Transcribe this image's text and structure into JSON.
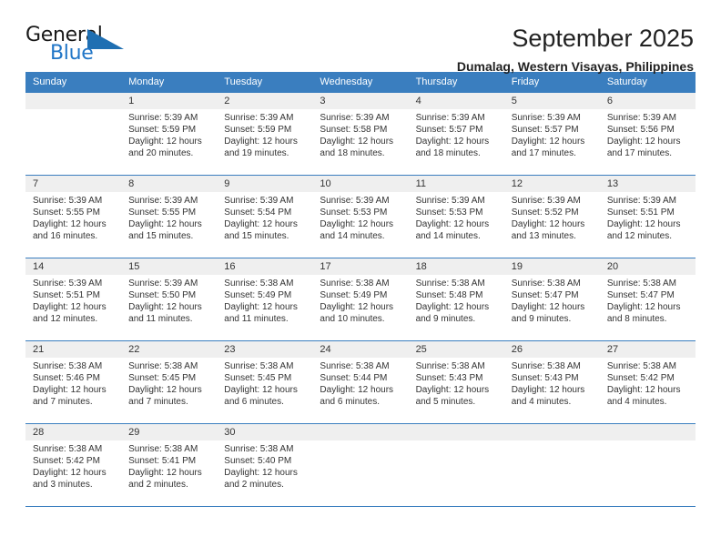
{
  "brand": {
    "word_one": "General",
    "word_two": "Blue",
    "triangle_icon": "triangle-icon"
  },
  "header": {
    "month_title": "September 2025",
    "location": "Dumalag, Western Visayas, Philippines"
  },
  "calendar": {
    "weekday_headers": [
      "Sunday",
      "Monday",
      "Tuesday",
      "Wednesday",
      "Thursday",
      "Friday",
      "Saturday"
    ],
    "colors": {
      "header_blue": "#3a7ebf",
      "daynum_gray": "#efefef",
      "brand_blue": "#2176c7",
      "text": "#333333"
    },
    "weeks": [
      [
        {
          "day": "",
          "sunrise": "",
          "sunset": "",
          "daylight_line1": "",
          "daylight_line2": ""
        },
        {
          "day": "1",
          "sunrise": "Sunrise: 5:39 AM",
          "sunset": "Sunset: 5:59 PM",
          "daylight_line1": "Daylight: 12 hours",
          "daylight_line2": "and 20 minutes."
        },
        {
          "day": "2",
          "sunrise": "Sunrise: 5:39 AM",
          "sunset": "Sunset: 5:59 PM",
          "daylight_line1": "Daylight: 12 hours",
          "daylight_line2": "and 19 minutes."
        },
        {
          "day": "3",
          "sunrise": "Sunrise: 5:39 AM",
          "sunset": "Sunset: 5:58 PM",
          "daylight_line1": "Daylight: 12 hours",
          "daylight_line2": "and 18 minutes."
        },
        {
          "day": "4",
          "sunrise": "Sunrise: 5:39 AM",
          "sunset": "Sunset: 5:57 PM",
          "daylight_line1": "Daylight: 12 hours",
          "daylight_line2": "and 18 minutes."
        },
        {
          "day": "5",
          "sunrise": "Sunrise: 5:39 AM",
          "sunset": "Sunset: 5:57 PM",
          "daylight_line1": "Daylight: 12 hours",
          "daylight_line2": "and 17 minutes."
        },
        {
          "day": "6",
          "sunrise": "Sunrise: 5:39 AM",
          "sunset": "Sunset: 5:56 PM",
          "daylight_line1": "Daylight: 12 hours",
          "daylight_line2": "and 17 minutes."
        }
      ],
      [
        {
          "day": "7",
          "sunrise": "Sunrise: 5:39 AM",
          "sunset": "Sunset: 5:55 PM",
          "daylight_line1": "Daylight: 12 hours",
          "daylight_line2": "and 16 minutes."
        },
        {
          "day": "8",
          "sunrise": "Sunrise: 5:39 AM",
          "sunset": "Sunset: 5:55 PM",
          "daylight_line1": "Daylight: 12 hours",
          "daylight_line2": "and 15 minutes."
        },
        {
          "day": "9",
          "sunrise": "Sunrise: 5:39 AM",
          "sunset": "Sunset: 5:54 PM",
          "daylight_line1": "Daylight: 12 hours",
          "daylight_line2": "and 15 minutes."
        },
        {
          "day": "10",
          "sunrise": "Sunrise: 5:39 AM",
          "sunset": "Sunset: 5:53 PM",
          "daylight_line1": "Daylight: 12 hours",
          "daylight_line2": "and 14 minutes."
        },
        {
          "day": "11",
          "sunrise": "Sunrise: 5:39 AM",
          "sunset": "Sunset: 5:53 PM",
          "daylight_line1": "Daylight: 12 hours",
          "daylight_line2": "and 14 minutes."
        },
        {
          "day": "12",
          "sunrise": "Sunrise: 5:39 AM",
          "sunset": "Sunset: 5:52 PM",
          "daylight_line1": "Daylight: 12 hours",
          "daylight_line2": "and 13 minutes."
        },
        {
          "day": "13",
          "sunrise": "Sunrise: 5:39 AM",
          "sunset": "Sunset: 5:51 PM",
          "daylight_line1": "Daylight: 12 hours",
          "daylight_line2": "and 12 minutes."
        }
      ],
      [
        {
          "day": "14",
          "sunrise": "Sunrise: 5:39 AM",
          "sunset": "Sunset: 5:51 PM",
          "daylight_line1": "Daylight: 12 hours",
          "daylight_line2": "and 12 minutes."
        },
        {
          "day": "15",
          "sunrise": "Sunrise: 5:39 AM",
          "sunset": "Sunset: 5:50 PM",
          "daylight_line1": "Daylight: 12 hours",
          "daylight_line2": "and 11 minutes."
        },
        {
          "day": "16",
          "sunrise": "Sunrise: 5:38 AM",
          "sunset": "Sunset: 5:49 PM",
          "daylight_line1": "Daylight: 12 hours",
          "daylight_line2": "and 11 minutes."
        },
        {
          "day": "17",
          "sunrise": "Sunrise: 5:38 AM",
          "sunset": "Sunset: 5:49 PM",
          "daylight_line1": "Daylight: 12 hours",
          "daylight_line2": "and 10 minutes."
        },
        {
          "day": "18",
          "sunrise": "Sunrise: 5:38 AM",
          "sunset": "Sunset: 5:48 PM",
          "daylight_line1": "Daylight: 12 hours",
          "daylight_line2": "and 9 minutes."
        },
        {
          "day": "19",
          "sunrise": "Sunrise: 5:38 AM",
          "sunset": "Sunset: 5:47 PM",
          "daylight_line1": "Daylight: 12 hours",
          "daylight_line2": "and 9 minutes."
        },
        {
          "day": "20",
          "sunrise": "Sunrise: 5:38 AM",
          "sunset": "Sunset: 5:47 PM",
          "daylight_line1": "Daylight: 12 hours",
          "daylight_line2": "and 8 minutes."
        }
      ],
      [
        {
          "day": "21",
          "sunrise": "Sunrise: 5:38 AM",
          "sunset": "Sunset: 5:46 PM",
          "daylight_line1": "Daylight: 12 hours",
          "daylight_line2": "and 7 minutes."
        },
        {
          "day": "22",
          "sunrise": "Sunrise: 5:38 AM",
          "sunset": "Sunset: 5:45 PM",
          "daylight_line1": "Daylight: 12 hours",
          "daylight_line2": "and 7 minutes."
        },
        {
          "day": "23",
          "sunrise": "Sunrise: 5:38 AM",
          "sunset": "Sunset: 5:45 PM",
          "daylight_line1": "Daylight: 12 hours",
          "daylight_line2": "and 6 minutes."
        },
        {
          "day": "24",
          "sunrise": "Sunrise: 5:38 AM",
          "sunset": "Sunset: 5:44 PM",
          "daylight_line1": "Daylight: 12 hours",
          "daylight_line2": "and 6 minutes."
        },
        {
          "day": "25",
          "sunrise": "Sunrise: 5:38 AM",
          "sunset": "Sunset: 5:43 PM",
          "daylight_line1": "Daylight: 12 hours",
          "daylight_line2": "and 5 minutes."
        },
        {
          "day": "26",
          "sunrise": "Sunrise: 5:38 AM",
          "sunset": "Sunset: 5:43 PM",
          "daylight_line1": "Daylight: 12 hours",
          "daylight_line2": "and 4 minutes."
        },
        {
          "day": "27",
          "sunrise": "Sunrise: 5:38 AM",
          "sunset": "Sunset: 5:42 PM",
          "daylight_line1": "Daylight: 12 hours",
          "daylight_line2": "and 4 minutes."
        }
      ],
      [
        {
          "day": "28",
          "sunrise": "Sunrise: 5:38 AM",
          "sunset": "Sunset: 5:42 PM",
          "daylight_line1": "Daylight: 12 hours",
          "daylight_line2": "and 3 minutes."
        },
        {
          "day": "29",
          "sunrise": "Sunrise: 5:38 AM",
          "sunset": "Sunset: 5:41 PM",
          "daylight_line1": "Daylight: 12 hours",
          "daylight_line2": "and 2 minutes."
        },
        {
          "day": "30",
          "sunrise": "Sunrise: 5:38 AM",
          "sunset": "Sunset: 5:40 PM",
          "daylight_line1": "Daylight: 12 hours",
          "daylight_line2": "and 2 minutes."
        },
        {
          "day": "",
          "sunrise": "",
          "sunset": "",
          "daylight_line1": "",
          "daylight_line2": ""
        },
        {
          "day": "",
          "sunrise": "",
          "sunset": "",
          "daylight_line1": "",
          "daylight_line2": ""
        },
        {
          "day": "",
          "sunrise": "",
          "sunset": "",
          "daylight_line1": "",
          "daylight_line2": ""
        },
        {
          "day": "",
          "sunrise": "",
          "sunset": "",
          "daylight_line1": "",
          "daylight_line2": ""
        }
      ]
    ]
  }
}
